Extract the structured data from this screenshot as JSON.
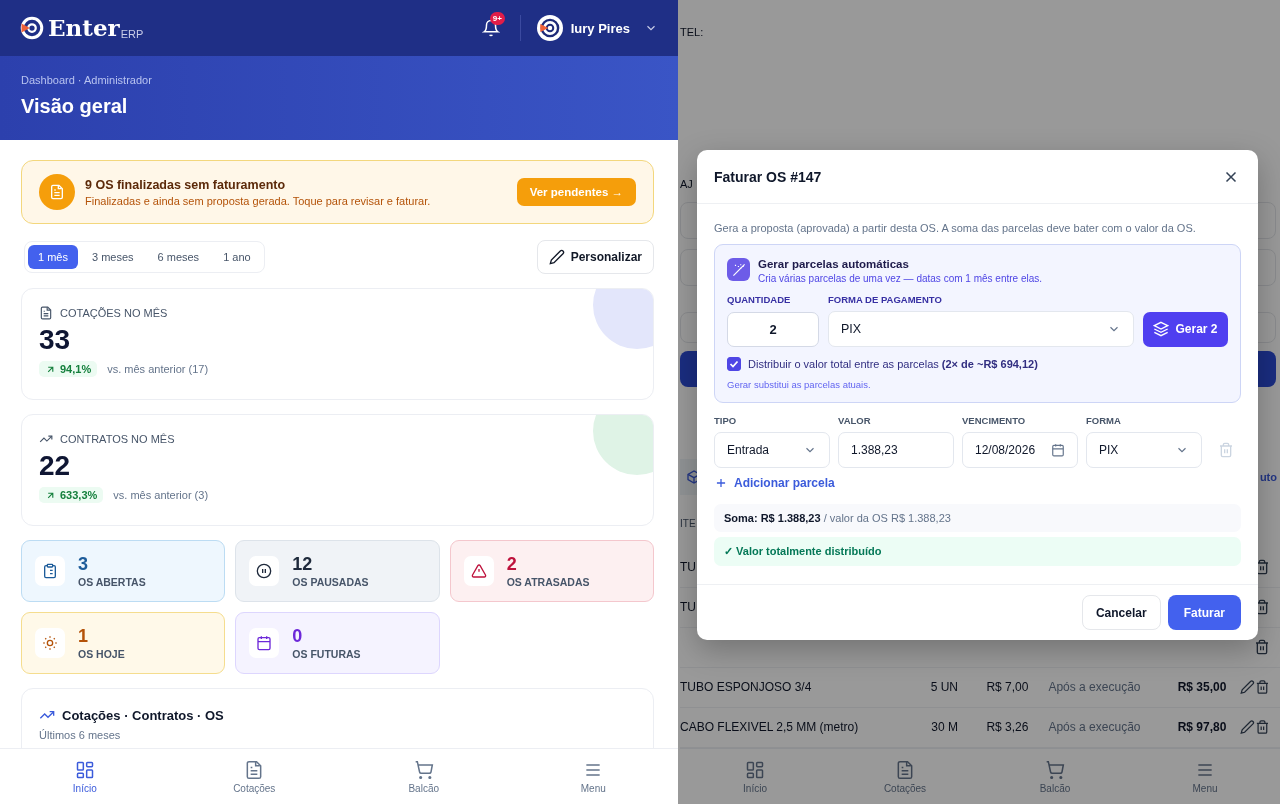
{
  "app": {
    "logo": "Enter",
    "logo_suffix": "ERP",
    "notifications_badge": "9+",
    "user_name": "Iury Pires"
  },
  "page_header": {
    "breadcrumb": "Dashboard · Administrador",
    "title": "Visão geral"
  },
  "alert": {
    "title": "9 OS finalizadas sem faturamento",
    "text": "Finalizadas e ainda sem proposta gerada. Toque para revisar e faturar.",
    "button": "Ver pendentes →"
  },
  "periods": [
    {
      "label": "1 mês",
      "selected": true
    },
    {
      "label": "3 meses",
      "selected": false
    },
    {
      "label": "6 meses",
      "selected": false
    },
    {
      "label": "1 ano",
      "selected": false
    }
  ],
  "customize_button": "Personalizar",
  "kpis": [
    {
      "kind": "quotes",
      "label": "COTAÇÕES NO MÊS",
      "value": "33",
      "change": "94,1%",
      "comparison": "vs. mês anterior (17)"
    },
    {
      "kind": "contracts",
      "label": "CONTRATOS NO MÊS",
      "value": "22",
      "change": "633,3%",
      "comparison": "vs. mês anterior (3)"
    }
  ],
  "status_tiles": [
    {
      "kind": "open",
      "value": "3",
      "label": "OS ABERTAS"
    },
    {
      "kind": "paused",
      "value": "12",
      "label": "OS PAUSADAS"
    },
    {
      "kind": "late",
      "value": "2",
      "label": "OS ATRASADAS"
    },
    {
      "kind": "today",
      "value": "1",
      "label": "OS HOJE"
    },
    {
      "kind": "future",
      "value": "0",
      "label": "OS FUTURAS"
    }
  ],
  "chart_section": {
    "title": "Cotações · Contratos · OS",
    "subtitle": "Últimos 6 meses"
  },
  "bottom_nav": [
    {
      "kind": "home",
      "label": "Início",
      "selected": true
    },
    {
      "kind": "quotes",
      "label": "Cotações",
      "selected": false
    },
    {
      "kind": "counter",
      "label": "Balcão",
      "selected": false
    },
    {
      "kind": "menu",
      "label": "Menu",
      "selected": false
    }
  ],
  "background_page": {
    "phone_label": "TEL:",
    "section_label": "AJ",
    "side_text": "uto",
    "column_header": "ITE",
    "rows": [
      {
        "kind": "partial",
        "name": "TU"
      },
      {
        "kind": "partial",
        "name": "TU"
      },
      {
        "kind": "hidden"
      },
      {
        "kind": "full",
        "name": "TUBO ESPONJOSO 3/4",
        "quantity": "5 UN",
        "unit_price": "R$ 7,00",
        "billing": "Após a execução",
        "total": "R$ 35,00"
      },
      {
        "kind": "full",
        "name": "CABO FLEXIVEL 2,5 MM (metro)",
        "quantity": "30 M",
        "unit_price": "R$ 3,26",
        "billing": "Após a execução",
        "total": "R$ 97,80"
      }
    ],
    "bottom_nav": [
      {
        "kind": "home",
        "label": "Início"
      },
      {
        "kind": "quotes",
        "label": "Cotações"
      },
      {
        "kind": "counter",
        "label": "Balcão"
      },
      {
        "kind": "menu",
        "label": "Menu"
      }
    ]
  },
  "modal": {
    "title": "Faturar OS #147",
    "description": "Gera a proposta (aprovada) a partir desta OS. A soma das parcelas deve bater com o valor da OS.",
    "auto": {
      "title": "Gerar parcelas automáticas",
      "subtitle": "Cria várias parcelas de uma vez — datas com 1 mês entre elas.",
      "quantity_label": "QUANTIDADE",
      "quantity": "2",
      "payment_label": "FORMA DE PAGAMENTO",
      "payment": "PIX",
      "generate_button": "Gerar 2",
      "distribute_checked": true,
      "distribute_text": "Distribuir o valor total entre as parcelas **(2× de ~R$ 694,12)**",
      "note": "Gerar substitui as parcelas atuais."
    },
    "installment_columns": [
      "TIPO",
      "VALOR",
      "VENCIMENTO",
      "FORMA"
    ],
    "installments": [
      {
        "type": "Entrada",
        "value": "1.388,23",
        "due": "12/08/2026",
        "method": "PIX"
      }
    ],
    "add_button": "Adicionar parcela",
    "sum": "**Soma: R$ 1.388,23** / valor da OS R$ 1.388,23",
    "status": "✓ Valor totalmente distribuído",
    "cancel_button": "Cancelar",
    "submit_button": "Faturar"
  }
}
